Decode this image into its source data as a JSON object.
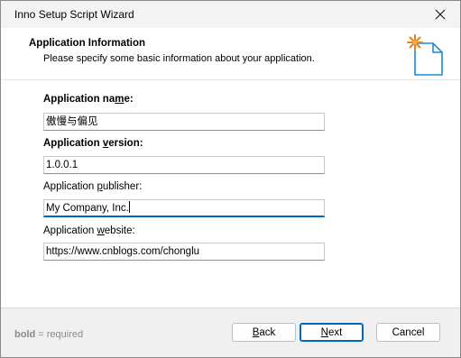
{
  "window": {
    "title": "Inno Setup Script Wizard"
  },
  "header": {
    "title": "Application Information",
    "subtitle": "Please specify some basic information about your application."
  },
  "fields": [
    {
      "label_pre": "Application na",
      "label_key": "m",
      "label_post": "e:",
      "value": "傲慢与偏见",
      "required": true
    },
    {
      "label_pre": "Application ",
      "label_key": "v",
      "label_post": "ersion:",
      "value": "1.0.0.1",
      "required": true
    },
    {
      "label_pre": "Application ",
      "label_key": "p",
      "label_post": "ublisher:",
      "value": "My Company, Inc.",
      "required": false
    },
    {
      "label_pre": "Application ",
      "label_key": "w",
      "label_post": "ebsite:",
      "value": "https://www.cnblogs.com/chonglu",
      "required": false
    }
  ],
  "footer": {
    "legend_bold": "bold",
    "legend_rest": " = required",
    "back_pre": "",
    "back_key": "B",
    "back_post": "ack",
    "next_pre": "",
    "next_key": "N",
    "next_post": "ext",
    "cancel": "Cancel"
  },
  "colors": {
    "accent": "#0067c0",
    "window_bg": "#f0f0f0",
    "panel_bg": "#ffffff"
  },
  "icons": [
    "close-icon",
    "wizard-document-icon"
  ]
}
